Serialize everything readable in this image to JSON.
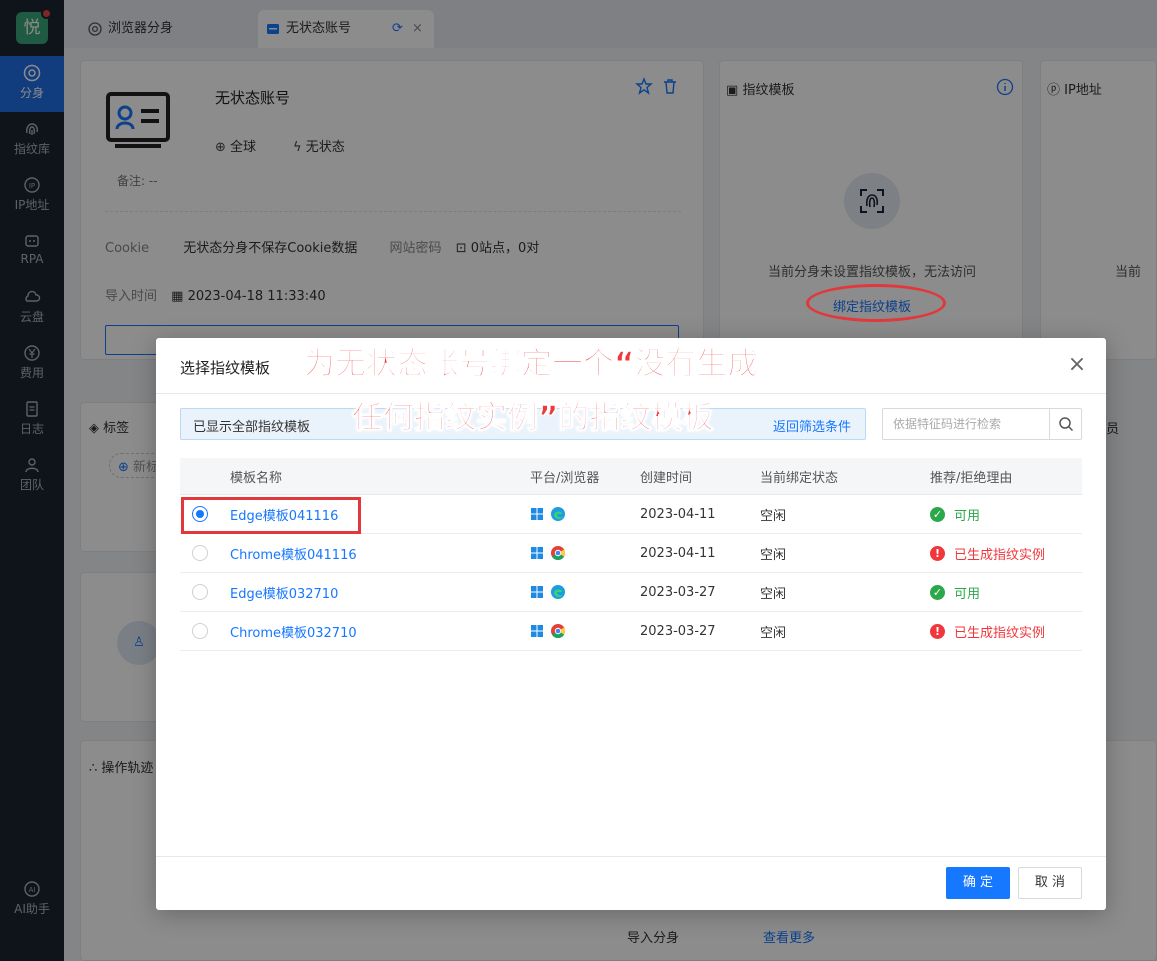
{
  "sidebar": {
    "logo": "悦",
    "items": [
      {
        "label": "分身",
        "icon": "chrome-icon"
      },
      {
        "label": "指纹库",
        "icon": "fingerprint-icon"
      },
      {
        "label": "IP地址",
        "icon": "ip-icon"
      },
      {
        "label": "RPA",
        "icon": "robot-icon"
      },
      {
        "label": "云盘",
        "icon": "cloud-icon"
      },
      {
        "label": "费用",
        "icon": "yen-icon"
      },
      {
        "label": "日志",
        "icon": "log-icon"
      },
      {
        "label": "团队",
        "icon": "team-icon"
      }
    ],
    "ai_label": "AI助手"
  },
  "tabs": [
    {
      "label": "浏览器分身"
    },
    {
      "label": "无状态账号"
    }
  ],
  "profile": {
    "name": "无状态账号",
    "region": "全球",
    "mode": "无状态",
    "remark_label": "备注:",
    "remark_value": "--",
    "cookie_label": "Cookie",
    "cookie_value": "无状态分身不保存Cookie数据",
    "password_label": "网站密码",
    "password_value": "0站点，0对",
    "import_label": "导入时间",
    "import_value": "2023-04-18 11:33:40",
    "tags_label": "标签",
    "tags_add": "新标",
    "track_label": "操作轨迹",
    "bottom_import": "导入分身",
    "bottom_more": "查看更多"
  },
  "fingerprint_card": {
    "title": "指纹模板",
    "empty_text": "当前分身未设置指纹模板，无法访问",
    "bind_link": "绑定指纹模板"
  },
  "ip_card": {
    "title": "IP地址",
    "empty_text": "当前",
    "member_label": "员"
  },
  "modal": {
    "title": "选择指纹模板",
    "filter_text": "已显示全部指纹模板",
    "filter_link": "返回筛选条件",
    "search_placeholder": "依据特征码进行检索",
    "columns": [
      "模板名称",
      "平台/浏览器",
      "创建时间",
      "当前绑定状态",
      "推荐/拒绝理由"
    ],
    "rows": [
      {
        "name": "Edge模板041116",
        "os": "windows",
        "browser": "edge",
        "date": "2023-04-11",
        "status": "空闲",
        "reason": "可用",
        "ok": true,
        "selected": true
      },
      {
        "name": "Chrome模板041116",
        "os": "windows",
        "browser": "chrome",
        "date": "2023-04-11",
        "status": "空闲",
        "reason": "已生成指纹实例",
        "ok": false,
        "selected": false
      },
      {
        "name": "Edge模板032710",
        "os": "windows",
        "browser": "edge",
        "date": "2023-03-27",
        "status": "空闲",
        "reason": "可用",
        "ok": true,
        "selected": false
      },
      {
        "name": "Chrome模板032710",
        "os": "windows",
        "browser": "chrome",
        "date": "2023-03-27",
        "status": "空闲",
        "reason": "已生成指纹实例",
        "ok": false,
        "selected": false
      }
    ],
    "ok_label": "确 定",
    "cancel_label": "取 消"
  },
  "annotation": {
    "line1": "为无状态账号绑定一个“没有生成",
    "line2": "任何指纹实例”的指纹模板"
  },
  "colors": {
    "primary": "#1677ff",
    "success": "#2aa84a",
    "danger": "#f0373b",
    "sidebar_bg": "#1d2431"
  }
}
